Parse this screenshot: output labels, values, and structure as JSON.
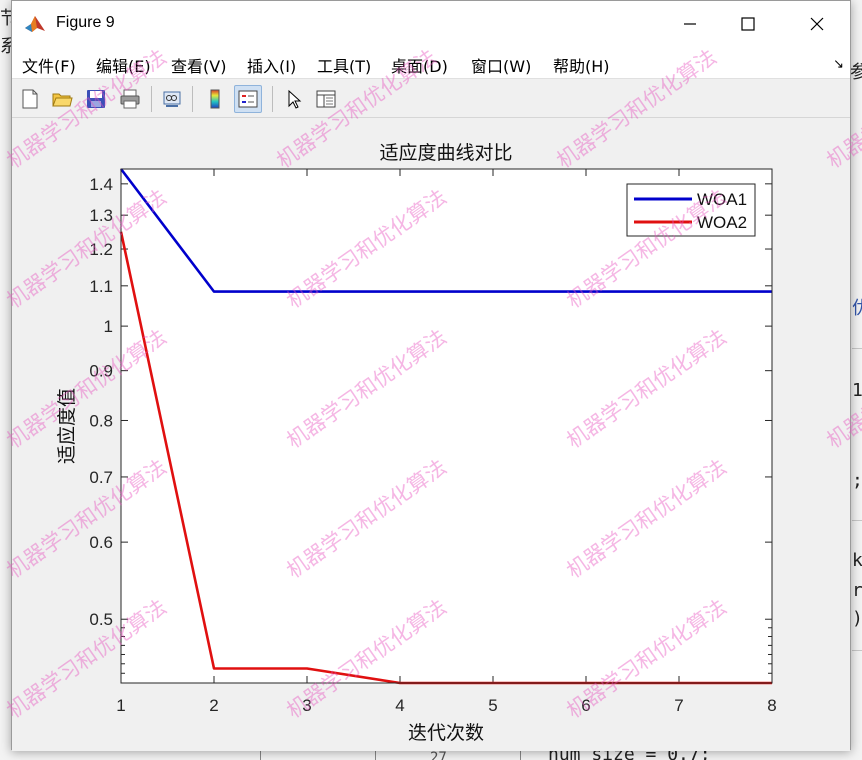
{
  "window": {
    "title": "Figure 9",
    "accent": "#0072bd"
  },
  "menu": [
    {
      "label": "文件(F)",
      "name": "menu-file"
    },
    {
      "label": "编辑(E)",
      "name": "menu-edit"
    },
    {
      "label": "查看(V)",
      "name": "menu-view"
    },
    {
      "label": "插入(I)",
      "name": "menu-insert"
    },
    {
      "label": "工具(T)",
      "name": "menu-tools"
    },
    {
      "label": "桌面(D)",
      "name": "menu-desktop"
    },
    {
      "label": "窗口(W)",
      "name": "menu-window"
    },
    {
      "label": "帮助(H)",
      "name": "menu-help"
    }
  ],
  "toolbar": [
    {
      "icon": "new-file-icon"
    },
    {
      "icon": "open-folder-icon"
    },
    {
      "icon": "save-icon"
    },
    {
      "icon": "print-icon"
    },
    {
      "icon": "link-plot-icon"
    },
    {
      "icon": "colorbar-icon"
    },
    {
      "icon": "legend-icon",
      "active": true
    },
    {
      "icon": "pointer-icon"
    },
    {
      "icon": "property-inspector-icon"
    }
  ],
  "background_text": {
    "top_left_1": "节",
    "top_left_2": "系",
    "right_1": "参",
    "right_2": "优",
    "right_3": "1",
    "right_4": ";",
    "right_5": "k",
    "right_6": "r",
    "right_7": ")",
    "bottom_left": "27",
    "bottom_code": "num_size = 0.7;"
  },
  "watermark": "机器学习和优化算法",
  "chart_data": {
    "type": "line",
    "title": "适应度曲线对比",
    "xlabel": "迭代次数",
    "ylabel": "适应度值",
    "y_scale": "log",
    "xlim": [
      1,
      8
    ],
    "ylim": [
      0.43,
      1.45
    ],
    "xticks": [
      1,
      2,
      3,
      4,
      5,
      6,
      7,
      8
    ],
    "yticks": [
      0.5,
      0.6,
      0.7,
      0.8,
      0.9,
      1,
      1.1,
      1.2,
      1.3,
      1.4
    ],
    "legend_position": "top-right",
    "x": [
      1,
      2,
      3,
      4,
      5,
      6,
      7,
      8
    ],
    "series": [
      {
        "name": "WOA1",
        "color": "#0000cc",
        "values": [
          1.45,
          1.085,
          1.085,
          1.085,
          1.085,
          1.085,
          1.085,
          1.085
        ]
      },
      {
        "name": "WOA2",
        "color": "#e01010",
        "values": [
          1.25,
          0.445,
          0.445,
          0.43,
          0.43,
          0.43,
          0.43,
          0.43
        ]
      }
    ]
  }
}
